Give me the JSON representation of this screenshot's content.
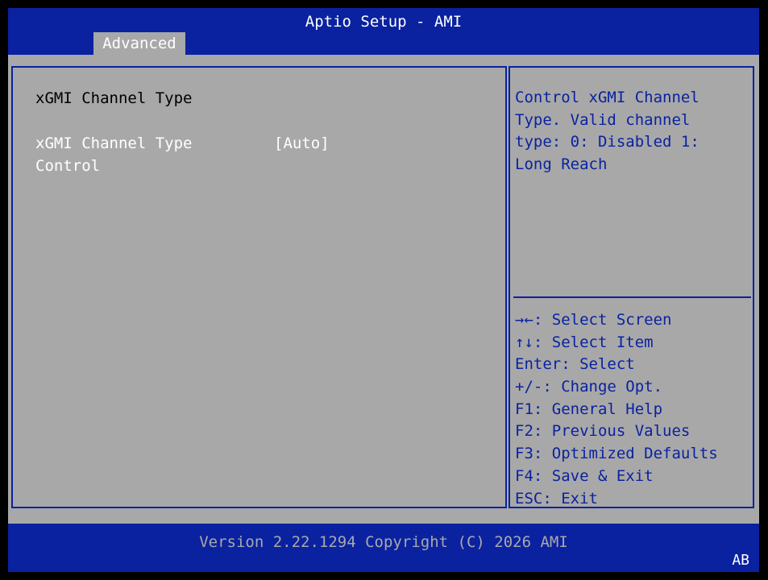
{
  "header": {
    "title": "Aptio Setup - AMI",
    "tabs": [
      {
        "label": "Advanced",
        "active": true
      }
    ]
  },
  "main": {
    "section_title": "xGMI Channel Type",
    "settings": [
      {
        "label": "xGMI Channel Type Control",
        "value": "[Auto]"
      }
    ]
  },
  "help": {
    "description": "Control xGMI Channel\nType. Valid channel\ntype: 0: Disabled 1:\nLong Reach",
    "keys": [
      "→←: Select Screen",
      "↑↓: Select Item",
      "Enter: Select",
      "+/-: Change Opt.",
      "F1: General Help",
      "F2: Previous Values",
      "F3: Optimized Defaults",
      "F4: Save & Exit",
      "ESC: Exit"
    ]
  },
  "footer": {
    "version": "Version 2.22.1294 Copyright (C) 2026 AMI",
    "corner": "AB"
  },
  "colors": {
    "bios_blue": "#0a22a0",
    "panel_gray": "#a8a8a8",
    "highlight_white": "#ffffff",
    "text_black": "#000000"
  }
}
